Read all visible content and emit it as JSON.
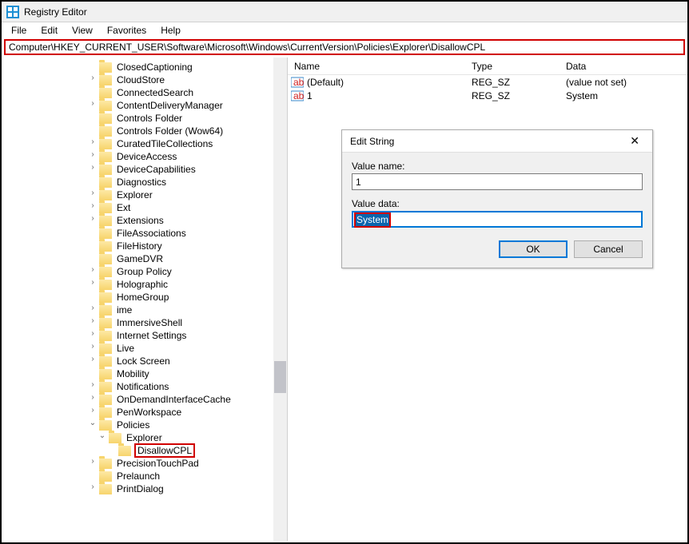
{
  "window": {
    "title": "Registry Editor"
  },
  "menu": {
    "file": "File",
    "edit": "Edit",
    "view": "View",
    "favorites": "Favorites",
    "help": "Help"
  },
  "address": {
    "path": "Computer\\HKEY_CURRENT_USER\\Software\\Microsoft\\Windows\\CurrentVersion\\Policies\\Explorer\\DisallowCPL"
  },
  "tree": {
    "items": [
      {
        "name": "ClosedCaptioning",
        "exp": ""
      },
      {
        "name": "CloudStore",
        "exp": ">"
      },
      {
        "name": "ConnectedSearch",
        "exp": ""
      },
      {
        "name": "ContentDeliveryManager",
        "exp": ">"
      },
      {
        "name": "Controls Folder",
        "exp": ""
      },
      {
        "name": "Controls Folder (Wow64)",
        "exp": ""
      },
      {
        "name": "CuratedTileCollections",
        "exp": ">"
      },
      {
        "name": "DeviceAccess",
        "exp": ">"
      },
      {
        "name": "DeviceCapabilities",
        "exp": ">"
      },
      {
        "name": "Diagnostics",
        "exp": ""
      },
      {
        "name": "Explorer",
        "exp": ">"
      },
      {
        "name": "Ext",
        "exp": ">"
      },
      {
        "name": "Extensions",
        "exp": ">"
      },
      {
        "name": "FileAssociations",
        "exp": ""
      },
      {
        "name": "FileHistory",
        "exp": ""
      },
      {
        "name": "GameDVR",
        "exp": ""
      },
      {
        "name": "Group Policy",
        "exp": ">"
      },
      {
        "name": "Holographic",
        "exp": ">"
      },
      {
        "name": "HomeGroup",
        "exp": ""
      },
      {
        "name": "ime",
        "exp": ">"
      },
      {
        "name": "ImmersiveShell",
        "exp": ">"
      },
      {
        "name": "Internet Settings",
        "exp": ">"
      },
      {
        "name": "Live",
        "exp": ">"
      },
      {
        "name": "Lock Screen",
        "exp": ">"
      },
      {
        "name": "Mobility",
        "exp": ""
      },
      {
        "name": "Notifications",
        "exp": ">"
      },
      {
        "name": "OnDemandInterfaceCache",
        "exp": ">"
      },
      {
        "name": "PenWorkspace",
        "exp": ">"
      },
      {
        "name": "Policies",
        "exp": "v",
        "children": [
          {
            "name": "Explorer",
            "exp": "v",
            "children": [
              {
                "name": "DisallowCPL",
                "exp": "",
                "selected": true
              }
            ]
          }
        ]
      },
      {
        "name": "PrecisionTouchPad",
        "exp": ">"
      },
      {
        "name": "Prelaunch",
        "exp": ""
      },
      {
        "name": "PrintDialog",
        "exp": ">"
      }
    ]
  },
  "columns": {
    "name": "Name",
    "type": "Type",
    "data": "Data"
  },
  "values": [
    {
      "name": "(Default)",
      "type": "REG_SZ",
      "data": "(value not set)"
    },
    {
      "name": "1",
      "type": "REG_SZ",
      "data": "System"
    }
  ],
  "dialog": {
    "title": "Edit String",
    "valuename_label": "Value name:",
    "valuename": "1",
    "valuedata_label": "Value data:",
    "valuedata": "System",
    "ok": "OK",
    "cancel": "Cancel"
  }
}
